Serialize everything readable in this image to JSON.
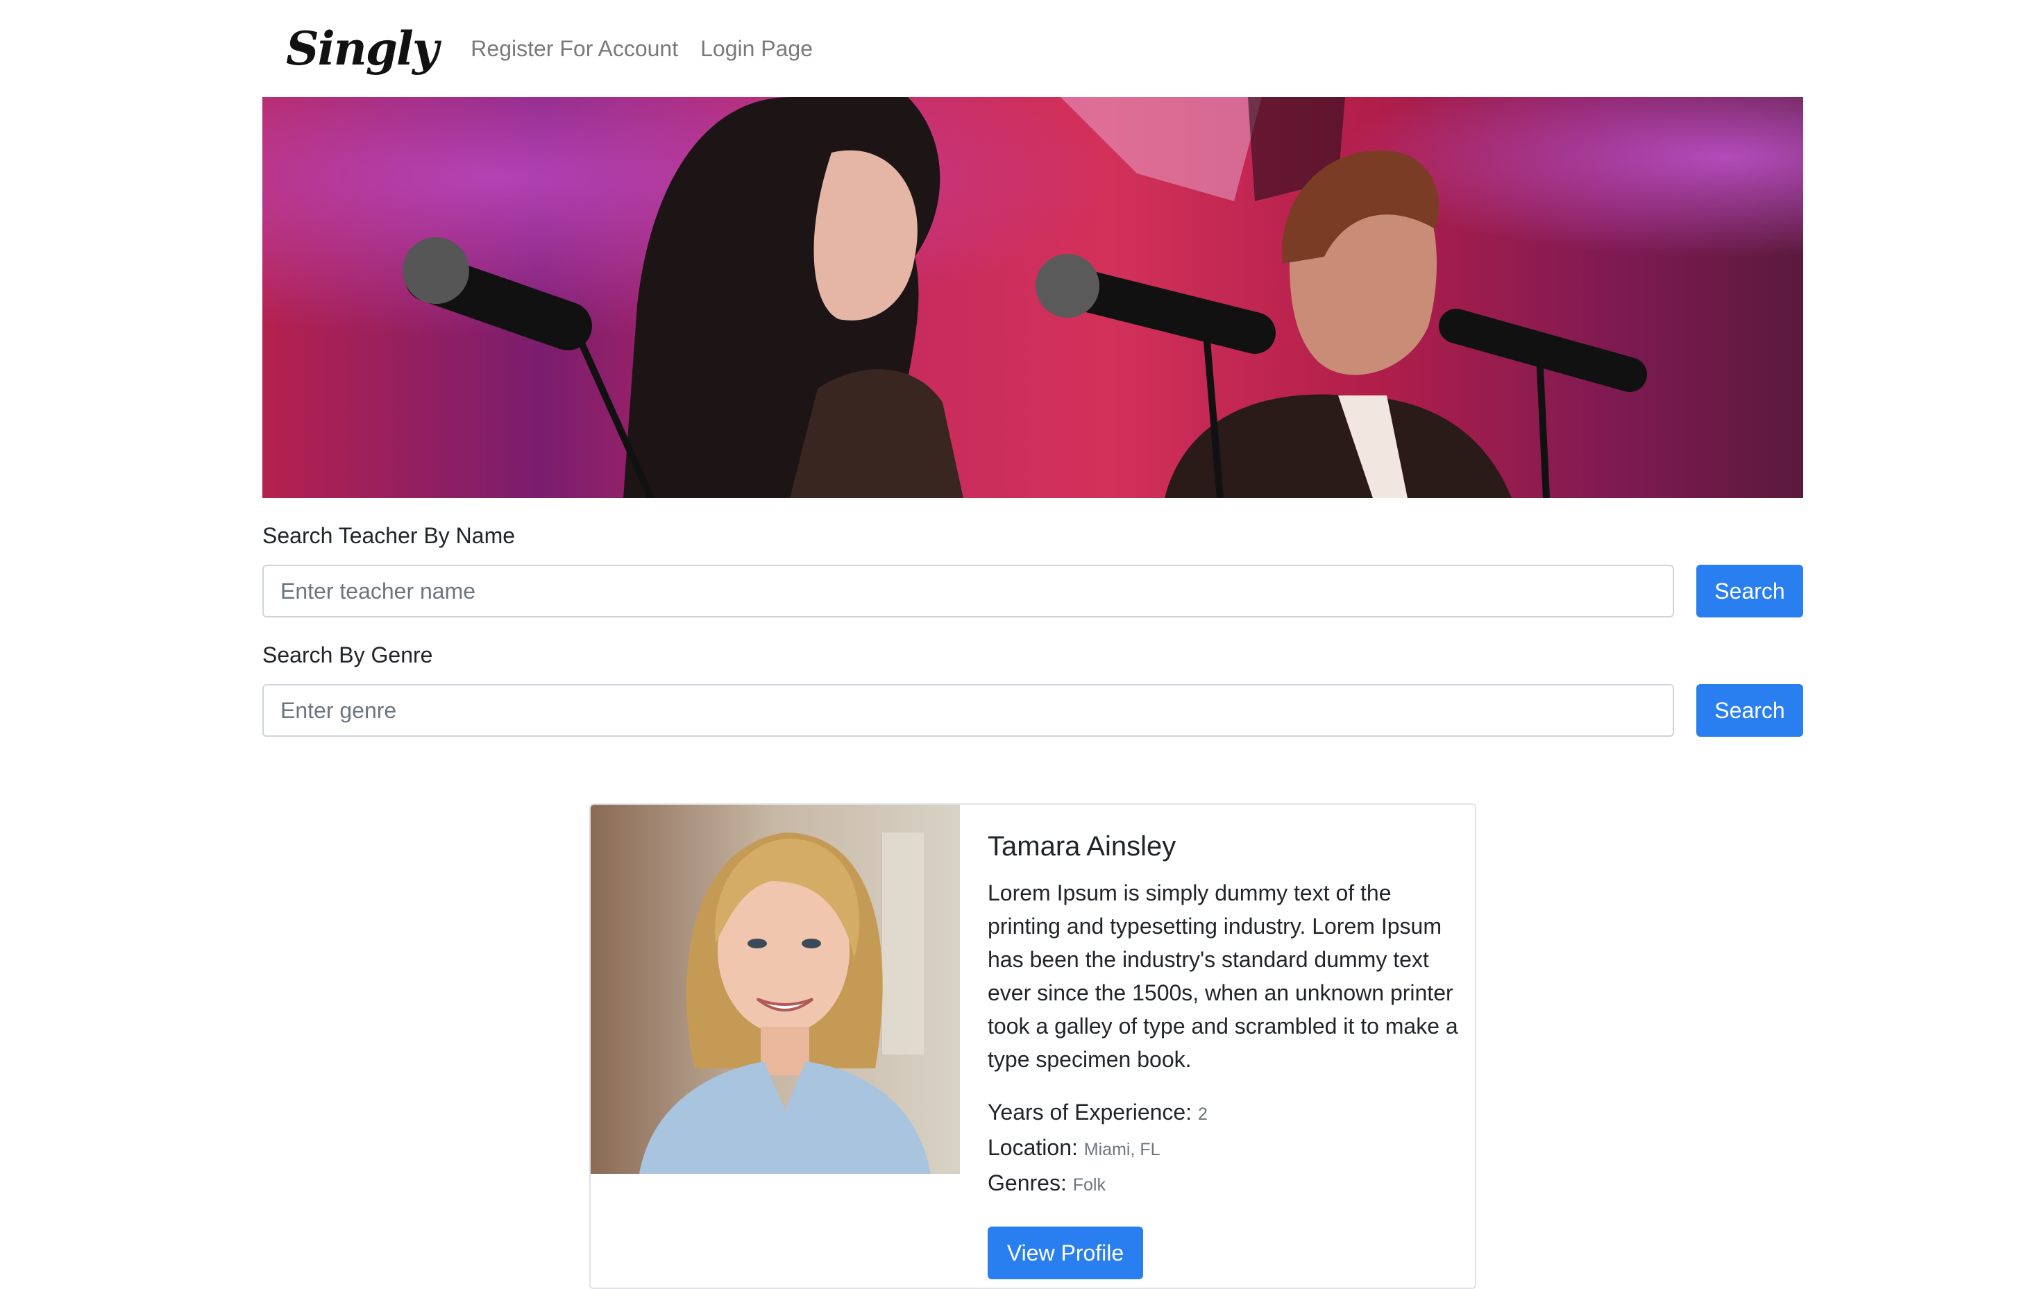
{
  "nav": {
    "brand": "Singly",
    "links": [
      "Register For Account",
      "Login Page"
    ]
  },
  "search_name": {
    "label": "Search Teacher By Name",
    "placeholder": "Enter teacher name",
    "button": "Search"
  },
  "search_genre": {
    "label": "Search By Genre",
    "placeholder": "Enter genre",
    "button": "Search"
  },
  "teacher": {
    "name": "Tamara Ainsley",
    "bio": "Lorem Ipsum is simply dummy text of the printing and typesetting industry. Lorem Ipsum has been the industry's standard dummy text ever since the 1500s, when an unknown printer took a galley of type and scrambled it to make a type specimen book.",
    "experience_label": "Years of Experience:",
    "experience_value": "2",
    "location_label": "Location:",
    "location_value": "Miami, FL",
    "genres_label": "Genres:",
    "genres_value": "Folk",
    "button": "View Profile"
  },
  "colors": {
    "primary": "#2a7ff0",
    "nav_link": "#7a7a7a",
    "muted": "#6c757d"
  }
}
